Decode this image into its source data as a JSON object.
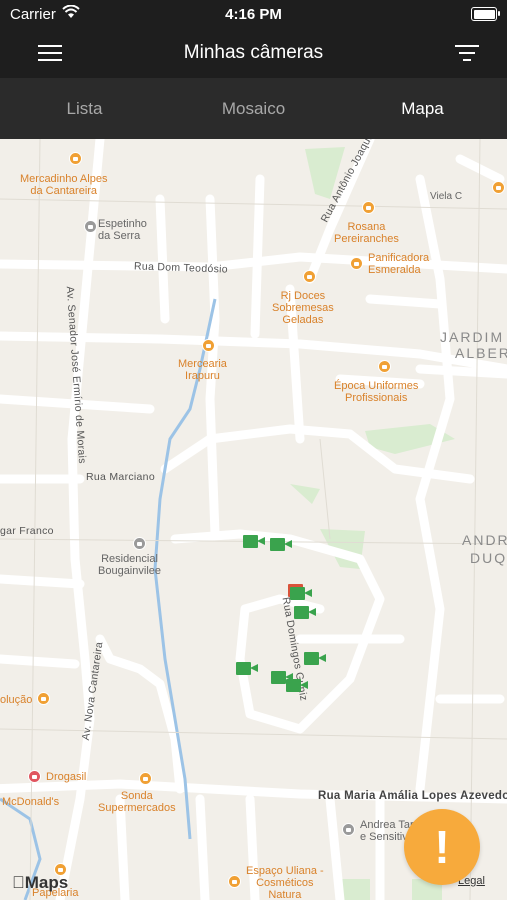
{
  "status_bar": {
    "carrier": "Carrier",
    "time": "4:16 PM"
  },
  "nav": {
    "title": "Minhas câmeras"
  },
  "tabs": [
    {
      "label": "Lista",
      "active": false
    },
    {
      "label": "Mosaico",
      "active": false
    },
    {
      "label": "Mapa",
      "active": true
    }
  ],
  "map": {
    "pois": [
      "Mercadinho Alpes\nda Cantareira",
      "Espetinho\nda Serra",
      "Rosana\nPereiranches",
      "Panificadora\nEsmeralda",
      "Rj Doces\nSobremesas\nGeladas",
      "Mercearia\nIrapuru",
      "Época Uniformes\nProfissionais",
      "Residencial\nBougainvilee",
      "Drogasil",
      "McDonald's",
      "Sonda\nSupermercados",
      "Andrea Tarolina\ne Sensitiva",
      "Espaço Uliana -\nCosméticos\nNatura",
      "Papelaria",
      "olução",
      "Viela C"
    ],
    "streets": [
      "Rua Antônio Joaquim",
      "Rua Dom Teodósio",
      "Av. Senador José Ermírio de Morais",
      "Rua Marciano",
      "gar Franco",
      "Rua Domingos Guniz",
      "Av. Nova Cantareira",
      "Rua Maria Amália Lopes Azevedo"
    ],
    "districts": [
      "JARDIM",
      "ALBER",
      "ANDR",
      "DUQ"
    ],
    "camera_count": 9,
    "attribution": "Maps",
    "legal": "Legal"
  },
  "fab": {
    "label": "!"
  },
  "colors": {
    "bar": "#1e1e1e",
    "tabs": "#2b2b2b",
    "camera": "#3aa34d",
    "fab": "#f7aa3c"
  }
}
